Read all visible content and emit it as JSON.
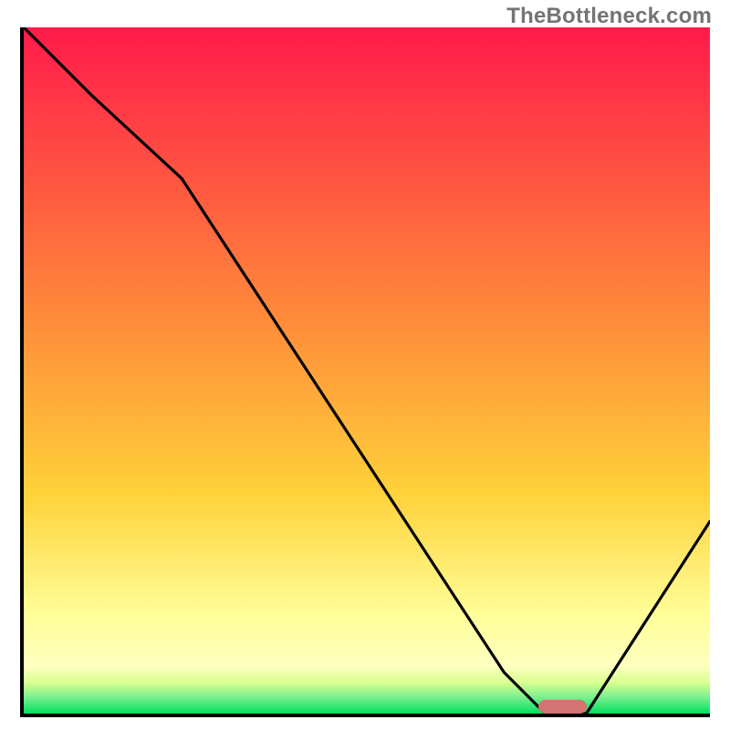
{
  "watermark": "TheBottleneck.com",
  "colors": {
    "gradient_top": "#ff1a4a",
    "gradient_mid_upper": "#ff7a3a",
    "gradient_mid": "#ffd23a",
    "gradient_yellow_pale": "#ffff9a",
    "gradient_green": "#00e060",
    "curve": "#000000",
    "axis": "#000000",
    "marker": "#d37373",
    "watermark_text": "#747474"
  },
  "chart_data": {
    "type": "line",
    "title": "",
    "xlabel": "",
    "ylabel": "",
    "xlim": [
      0,
      100
    ],
    "ylim": [
      0,
      100
    ],
    "grid": false,
    "legend_position": "none",
    "x": [
      0,
      10,
      23,
      70,
      76,
      82,
      100
    ],
    "values": [
      100,
      90,
      78,
      6,
      0,
      0,
      28
    ],
    "marker": {
      "x_start": 75,
      "x_end": 82,
      "y": 0
    },
    "gradient_stops": [
      {
        "pos": 0.0,
        "color": "#ff1a4a"
      },
      {
        "pos": 0.42,
        "color": "#ff8a3a"
      },
      {
        "pos": 0.68,
        "color": "#ffd23a"
      },
      {
        "pos": 0.86,
        "color": "#ffff9a"
      },
      {
        "pos": 0.93,
        "color": "#ffffc0"
      },
      {
        "pos": 0.955,
        "color": "#d8ff90"
      },
      {
        "pos": 0.975,
        "color": "#80f090"
      },
      {
        "pos": 1.0,
        "color": "#00e060"
      }
    ]
  }
}
